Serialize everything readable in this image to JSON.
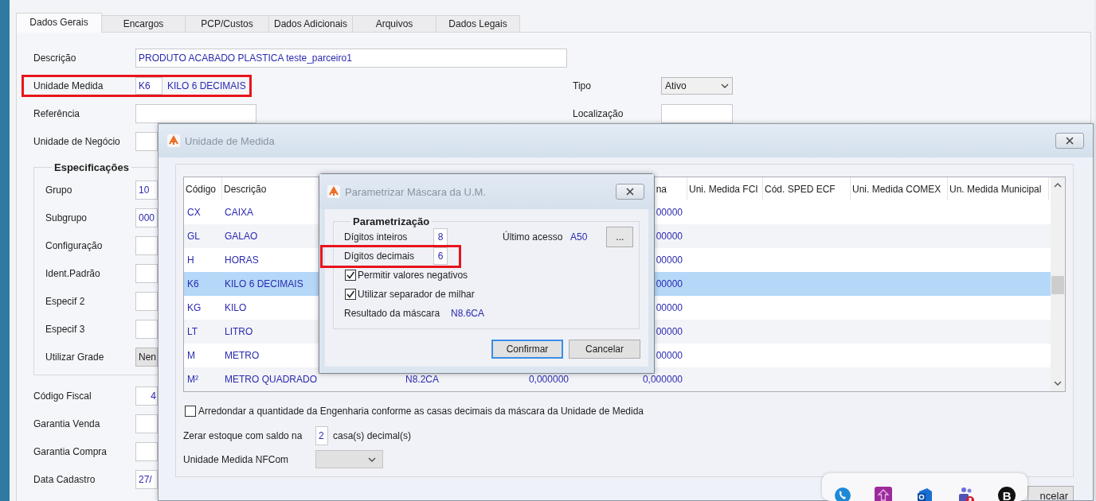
{
  "tabs": [
    {
      "label": "Dados Gerais",
      "selected": true
    },
    {
      "label": "Encargos",
      "selected": false
    },
    {
      "label": "PCP/Custos",
      "selected": false
    },
    {
      "label": "Dados Adicionais",
      "selected": false
    },
    {
      "label": "Arquivos",
      "selected": false
    },
    {
      "label": "Dados Legais",
      "selected": false
    }
  ],
  "form": {
    "rows": [
      {
        "label": "Descrição",
        "value": "PRODUTO ACABADO PLASTICA teste_parceiro1",
        "kind": "wide",
        "highlighted": false
      },
      {
        "label": "Unidade Medida",
        "value": "K6",
        "note": "KILO 6 DECIMAIS",
        "kind": "code",
        "highlighted": true,
        "side": {
          "label": "Tipo",
          "value": "Ativo",
          "kind": "select"
        }
      },
      {
        "label": "Referência",
        "kind": "medium",
        "highlighted": false,
        "side": {
          "label": "Localização",
          "kind": "short"
        }
      },
      {
        "label": "Unidade de Negócio",
        "kind": "cut",
        "highlighted": false
      }
    ],
    "specs": {
      "title": "Especificações",
      "rows": [
        {
          "label": "Grupo",
          "value": "10",
          "kind": "cut"
        },
        {
          "label": "Subgrupo",
          "value": "000",
          "kind": "cut"
        },
        {
          "label": "Configuração",
          "kind": "cut"
        },
        {
          "label": "Ident.Padrão",
          "kind": "cut"
        },
        {
          "label": "Especif 2",
          "kind": "cut"
        },
        {
          "label": "Especif 3",
          "kind": "cut"
        },
        {
          "label": "Utilizar Grade",
          "value": "Nen",
          "kind": "select_cut"
        }
      ]
    },
    "more_rows": [
      {
        "label": "Código Fiscal",
        "value": "4",
        "kind": "cut_right"
      },
      {
        "label": "Garantia Venda",
        "kind": "cut"
      },
      {
        "label": "Garantia Compra",
        "kind": "cut"
      },
      {
        "label": "Data Cadastro",
        "value": "27/",
        "kind": "cut"
      }
    ]
  },
  "unit_dialog": {
    "title": "Unidade de Medida",
    "header": {
      "code": "Código",
      "description": "Descrição",
      "column_5": "na",
      "fci": "Uni. Medida FCI",
      "sped": "Cód. SPED ECF",
      "comex": "Uni. Medida COMEX",
      "municipal": "Un. Medida Municipal"
    },
    "rows": [
      {
        "code": "CX",
        "description": "CAIXA",
        "column_5": "00000",
        "selected": false
      },
      {
        "code": "GL",
        "description": "GALAO",
        "column_5": "00000",
        "selected": false
      },
      {
        "code": "H",
        "description": "HORAS",
        "column_5": "00000",
        "selected": false
      },
      {
        "code": "K6",
        "description": "KILO 6 DECIMAIS",
        "column_5": "00000",
        "selected": true
      },
      {
        "code": "KG",
        "description": "KILO",
        "column_5": "00000",
        "selected": false
      },
      {
        "code": "LT",
        "description": "LITRO",
        "column_5": "00000",
        "selected": false
      },
      {
        "code": "M",
        "description": "METRO",
        "column_5": "00000",
        "selected": false
      },
      {
        "code": "M²",
        "description": "METRO QUADRADO",
        "column_3": "N8.2CA",
        "column_4": "0,000000",
        "column_5": "0,000000",
        "selected": false
      }
    ],
    "round_option": {
      "label": "Arredondar a quantidade da Engenharia conforme as casas decimais da máscara da Unidade de Medida",
      "checked": false
    },
    "zero_stock": {
      "label": "Zerar estoque com saldo na",
      "value": "2",
      "suffix": "casa(s) decimal(s)"
    },
    "nfcom": {
      "label": "Unidade Medida NFCom",
      "disabled": true
    },
    "button": "ncelar"
  },
  "param_dialog": {
    "title": "Parametrizar Máscara da U.M.",
    "group": "Parametrização",
    "digits": [
      {
        "label": "Dígitos inteiros",
        "value": "8",
        "highlighted": false
      },
      {
        "label": "Dígitos decimais",
        "value": "6",
        "highlighted": true
      }
    ],
    "last_access": {
      "label": "Último acesso",
      "value": "A50",
      "button": "..."
    },
    "checks": [
      {
        "label": "Permitir valores negativos",
        "checked": true
      },
      {
        "label": "Utilizar separador de milhar",
        "checked": true
      }
    ],
    "result": {
      "label": "Resultado da máscara",
      "value": "N8.6CA"
    },
    "buttons": [
      {
        "label": "Confirmar",
        "focused": true
      },
      {
        "label": "Cancelar",
        "focused": false
      }
    ]
  },
  "tray": {
    "icons": [
      {
        "kind": "phone"
      },
      {
        "kind": "upload"
      },
      {
        "kind": "mail"
      },
      {
        "kind": "people"
      },
      {
        "kind": "letter",
        "glyph": "B"
      }
    ]
  }
}
